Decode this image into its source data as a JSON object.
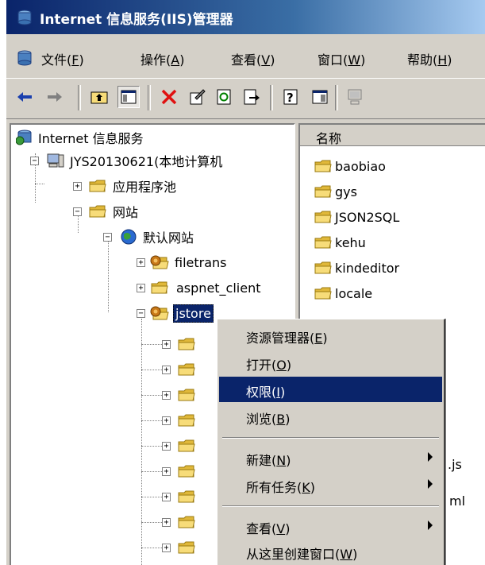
{
  "window": {
    "title": "Internet 信息服务(IIS)管理器"
  },
  "menu": [
    {
      "label": "文件(",
      "key": "F",
      "end": ")"
    },
    {
      "label": "操作(",
      "key": "A",
      "end": ")"
    },
    {
      "label": "查看(",
      "key": "V",
      "end": ")"
    },
    {
      "label": "窗口(",
      "key": "W",
      "end": ")"
    },
    {
      "label": "帮助(",
      "key": "H",
      "end": ")"
    }
  ],
  "toolbar": {
    "buttons": [
      "back-icon",
      "forward-icon",
      "up-folder-icon",
      "show-tree-icon",
      "delete-icon",
      "properties-icon",
      "refresh-icon",
      "export-icon",
      "help-icon",
      "console-icon",
      "computer-icon"
    ]
  },
  "tree": {
    "root": "Internet 信息服务",
    "computer": "JYS20130621(本地计算机",
    "app_pools": "应用程序池",
    "websites": "网站",
    "default_site": "默认网站",
    "children": [
      "filetrans",
      "aspnet_client",
      "jstore"
    ]
  },
  "list": {
    "column_header": "名称",
    "items": [
      "baobiao",
      "gys",
      "JSON2SQL",
      "kehu",
      "kindeditor",
      "locale"
    ],
    "partial_js": ".js",
    "partial_ml": "ml"
  },
  "context_menu": {
    "items": [
      {
        "label": "资源管理器(",
        "key": "E",
        "end": ")"
      },
      {
        "label": "打开(",
        "key": "O",
        "end": ")"
      },
      {
        "label": "权限(",
        "key": "I",
        "end": ")"
      },
      {
        "label": "浏览(",
        "key": "B",
        "end": ")"
      },
      {
        "label": "新建(",
        "key": "N",
        "end": ")"
      },
      {
        "label": "所有任务(",
        "key": "K",
        "end": ")"
      },
      {
        "label": "查看(",
        "key": "V",
        "end": ")"
      },
      {
        "label": "从这里创建窗口(",
        "key": "W",
        "end": ")"
      }
    ],
    "highlighted": "权限(I)"
  },
  "colors": {
    "title_start": "#0a246a",
    "title_end": "#a6caf0",
    "highlight": "#0a246a",
    "face": "#d4d0c8",
    "folder": "#f5d76e"
  }
}
